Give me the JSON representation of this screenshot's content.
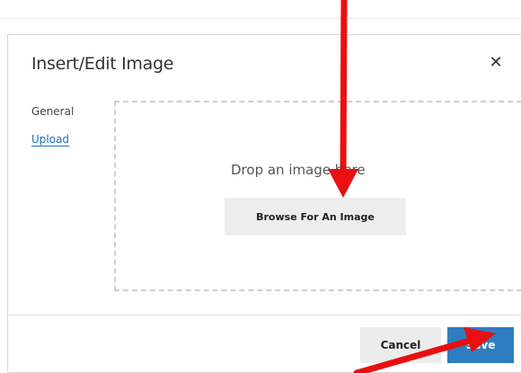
{
  "dialog": {
    "title": "Insert/Edit Image",
    "close_icon": "close-icon"
  },
  "tabs": {
    "general_label": "General",
    "upload_label": "Upload"
  },
  "dropzone": {
    "text": "Drop an image here",
    "browse_label": "Browse For An Image"
  },
  "footer": {
    "cancel_label": "Cancel",
    "save_label": "Save"
  },
  "annotations": {
    "arrow_color": "#e81010"
  }
}
